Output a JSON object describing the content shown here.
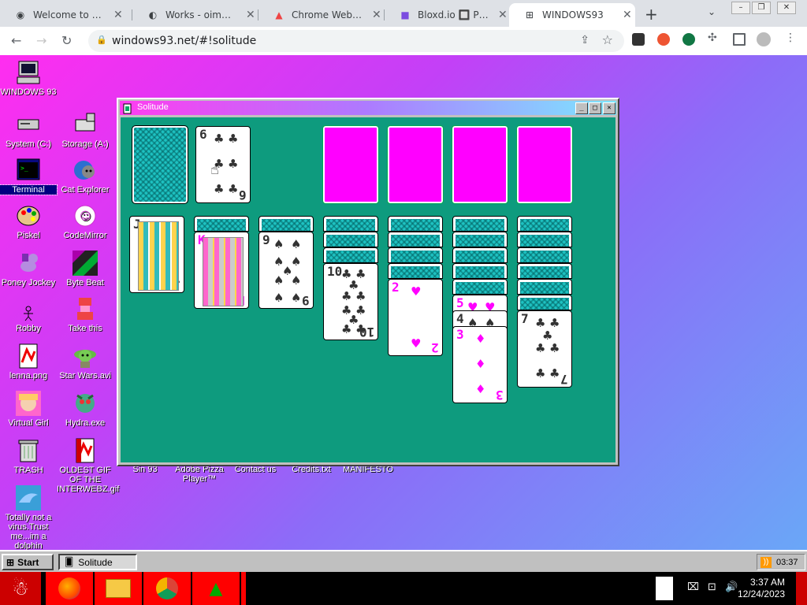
{
  "browser": {
    "tabs": [
      {
        "title": "Welcome to Chro",
        "icon": "chrome-icon"
      },
      {
        "title": "Works - oimo.io",
        "icon": "oimo-icon"
      },
      {
        "title": "Chrome Web Stor",
        "icon": "webstore-icon"
      },
      {
        "title": "Bloxd.io 🔲 Play or",
        "icon": "bloxd-icon"
      },
      {
        "title": "WINDOWS93",
        "icon": "windows93-icon"
      }
    ],
    "url": "windows93.net/#!solitude",
    "window_controls": [
      "–",
      "❐",
      "✕"
    ]
  },
  "desktop": {
    "icons": [
      {
        "label": "WINDOWS 93",
        "icon": "computer-icon"
      },
      {
        "label": "System (C:)",
        "icon": "drive-icon"
      },
      {
        "label": "Storage (A:)",
        "icon": "floppy-icon"
      },
      {
        "label": "Terminal",
        "icon": "terminal-icon"
      },
      {
        "label": "Cat Explorer",
        "icon": "cat-explorer-icon"
      },
      {
        "label": "Piskel",
        "icon": "palette-icon"
      },
      {
        "label": "CodeMirror",
        "icon": "codemirror-icon"
      },
      {
        "label": "Poney Jockey",
        "icon": "pony-icon"
      },
      {
        "label": "Byte Beat",
        "icon": "bytebeat-icon"
      },
      {
        "label": "Robby",
        "icon": "stickman-icon"
      },
      {
        "label": "Take this",
        "icon": "take-this-icon"
      },
      {
        "label": "lenna.png",
        "icon": "image-file-icon"
      },
      {
        "label": "Star Wars.avi",
        "icon": "yoda-icon"
      },
      {
        "label": "Virtual Girl",
        "icon": "face-icon"
      },
      {
        "label": "Hydra.exe",
        "icon": "hydra-icon"
      },
      {
        "label": "TRASH",
        "icon": "trash-icon"
      },
      {
        "label": "OLDEST GIF OF THE INTERWEBZ.gif",
        "icon": "gif-file-icon"
      },
      {
        "label": "Totally not a virus.Trust me...im a dolphin",
        "icon": "dolphin-icon"
      }
    ],
    "hidden_labels": [
      "Sin 93",
      "Adobe Pizza Player™",
      "Contact us",
      "Credits.txt",
      "MANIFESTO"
    ]
  },
  "solitude": {
    "title": "Solitude",
    "waste_card": {
      "rank": "6",
      "suit": "♣"
    },
    "tableau_top": [
      {
        "rank": "J",
        "suit": "♣",
        "color": "blk"
      },
      {
        "rank": "K",
        "suit": "♥",
        "color": "red"
      },
      {
        "rank": "9",
        "suit": "♠",
        "color": "blk"
      },
      {
        "rank": "10",
        "suit": "♣",
        "color": "blk"
      },
      {
        "rank": "2",
        "suit": "♥",
        "color": "red"
      },
      {
        "rank": "3",
        "suit": "♦",
        "color": "red"
      },
      {
        "rank": "7",
        "suit": "♣",
        "color": "blk"
      }
    ],
    "col6_partial": [
      {
        "rank": "5",
        "suit": "♥"
      },
      {
        "rank": "4",
        "suit": "♠"
      }
    ]
  },
  "taskbar93": {
    "start_label": "Start",
    "task_label": "Solitude",
    "tray_time": "03:37"
  },
  "os_taskbar": {
    "time": "3:37 AM",
    "date": "12/24/2023"
  },
  "colors": {
    "felt": "#0e9b7e",
    "foundation": "#ff00ff",
    "card_back": "#1ec2c2"
  }
}
